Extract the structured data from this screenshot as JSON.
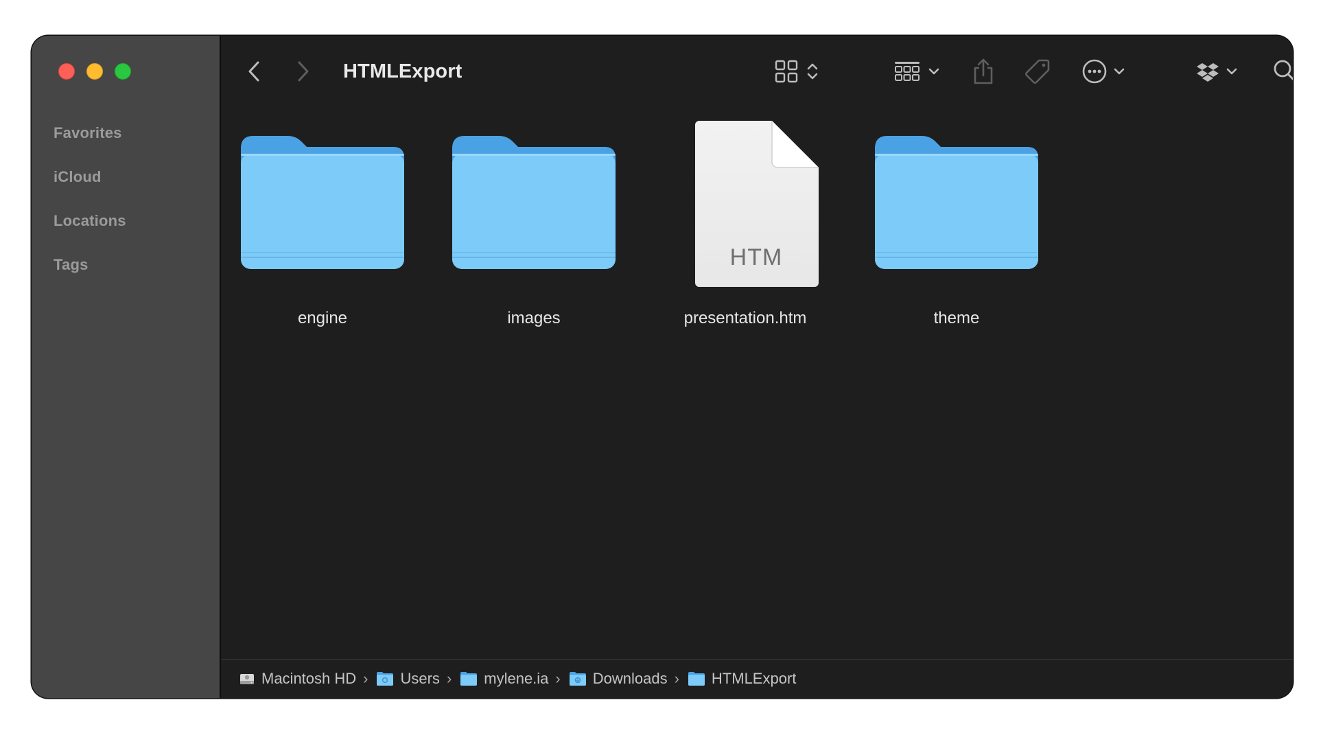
{
  "sidebar": {
    "sections": [
      {
        "label": "Favorites"
      },
      {
        "label": "iCloud"
      },
      {
        "label": "Locations"
      },
      {
        "label": "Tags"
      }
    ]
  },
  "toolbar": {
    "title": "HTMLExport",
    "icons": [
      "chevron-left-icon",
      "chevron-right-icon",
      "grid-view-icon",
      "sort-updown-icon",
      "group-icon",
      "share-icon",
      "tag-icon",
      "more-icon",
      "dropbox-icon",
      "search-icon"
    ]
  },
  "items": [
    {
      "name": "engine",
      "kind": "folder"
    },
    {
      "name": "images",
      "kind": "folder"
    },
    {
      "name": "presentation.htm",
      "kind": "document",
      "ext": "HTM"
    },
    {
      "name": "theme",
      "kind": "folder"
    }
  ],
  "pathbar": {
    "crumbs": [
      {
        "label": "Macintosh HD",
        "icon": "hard-drive-icon"
      },
      {
        "label": "Users",
        "icon": "users-folder-icon"
      },
      {
        "label": "mylene.ia",
        "icon": "folder-icon"
      },
      {
        "label": "Downloads",
        "icon": "downloads-folder-icon"
      },
      {
        "label": "HTMLExport",
        "icon": "folder-icon"
      }
    ]
  },
  "colors": {
    "sidebar_bg": "#464646",
    "content_bg": "#1e1e1e",
    "folder_front": "#7ccbf9",
    "folder_back": "#4aa2e4",
    "red": "#fe5f57",
    "yellow": "#febc2e",
    "green": "#28c840"
  }
}
